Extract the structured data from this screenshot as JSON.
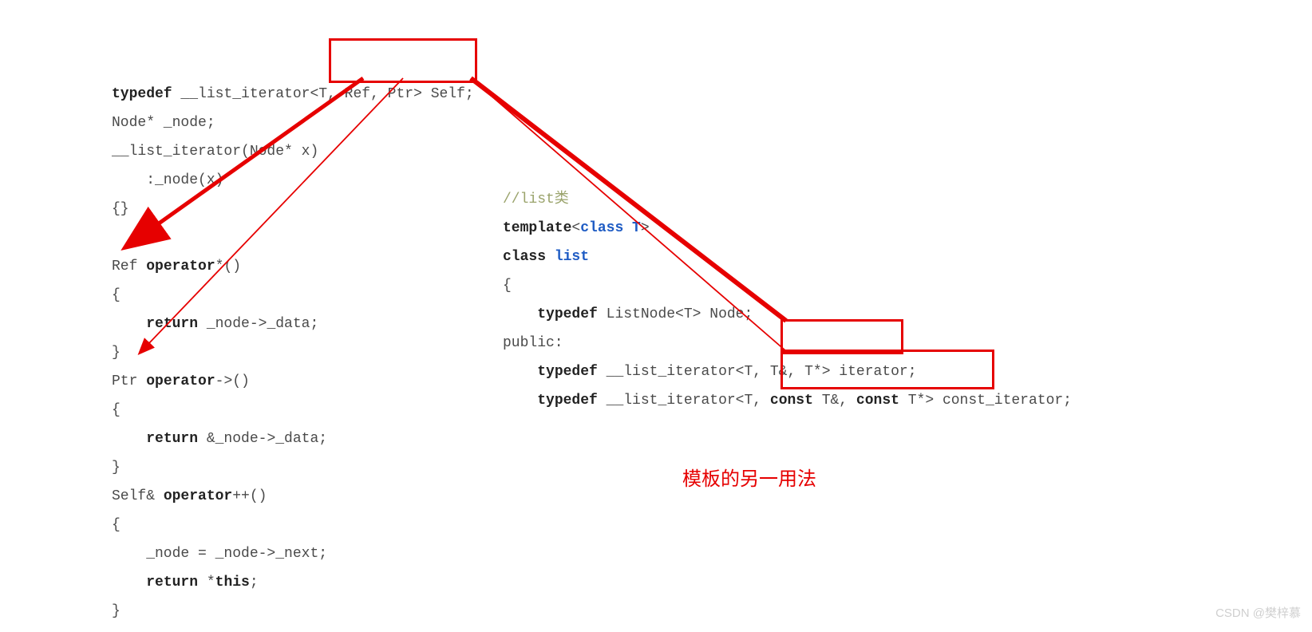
{
  "left_code": {
    "l1a": "typedef",
    "l1b": " __list_iterator",
    "l1c": "<T, Ref, Ptr>",
    "l1d": " Self;",
    "l2": "Node* _node;",
    "l3": "__list_iterator(Node* x)",
    "l4": "    :_node(x)",
    "l5": "{}",
    "l6": "",
    "l7a": "Ref ",
    "l7b": "operator",
    "l7c": "*()",
    "l8": "{",
    "l9a": "    ",
    "l9b": "return",
    "l9c": " _node->_data;",
    "l10": "}",
    "l11a": "Ptr ",
    "l11b": "operator",
    "l11c": "->()",
    "l12": "{",
    "l13a": "    ",
    "l13b": "return",
    "l13c": " &_node->_data;",
    "l14": "}",
    "l15a": "Self& ",
    "l15b": "operator",
    "l15c": "++()",
    "l16": "{",
    "l17": "    _node = _node->_next;",
    "l18a": "    ",
    "l18b": "return",
    "l18c": " *",
    "l18d": "this",
    "l18e": ";",
    "l19": "}"
  },
  "right_code": {
    "c1": "//list类",
    "t1a": "template",
    "t1b": "<",
    "t1c": "class T",
    "t1d": ">",
    "cl1a": "class ",
    "cl1b": "list",
    "ob": "{",
    "td1a": "    ",
    "td1b": "typedef",
    "td1c": " ListNode<T> Node;",
    "pub": "public:",
    "it1a": "    ",
    "it1b": "typedef",
    "it1c": " __list_iterator",
    "it1d": "<T, T&, T*>",
    "it1e": " iterator;",
    "it2a": "    ",
    "it2b": "typedef",
    "it2c": " __list_iterator",
    "it2d_pre": "<T, ",
    "it2d_c1": "const",
    "it2d_mid": " T&, ",
    "it2d_c2": "const",
    "it2d_end": " T*>",
    "it2e": " const_iterator;"
  },
  "annotation": "模板的另一用法",
  "watermark": "CSDN @樊梓慕"
}
